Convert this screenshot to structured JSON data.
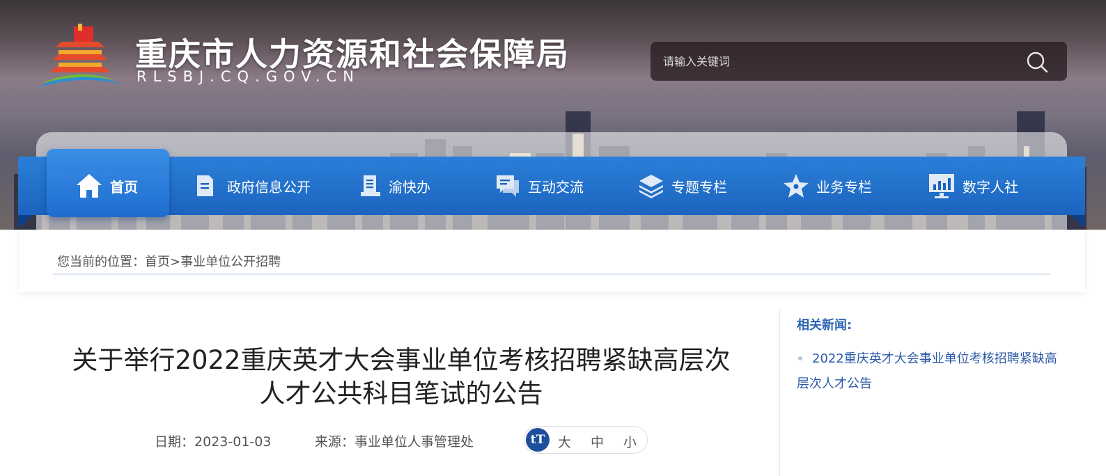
{
  "header": {
    "site_title": "重庆市人力资源和社会保障局",
    "site_domain": "RLSBJ.CQ.GOV.CN",
    "search_placeholder": "请输入关键词",
    "logo_icon": "temple-logo-icon",
    "search_icon": "search-icon"
  },
  "nav": {
    "items": [
      {
        "label": "首页",
        "icon": "home-icon",
        "active": true
      },
      {
        "label": "政府信息公开",
        "icon": "document-icon"
      },
      {
        "label": "渝快办",
        "icon": "book-icon"
      },
      {
        "label": "互动交流",
        "icon": "chat-icon"
      },
      {
        "label": "专题专栏",
        "icon": "layers-icon"
      },
      {
        "label": "业务专栏",
        "icon": "star-icon"
      },
      {
        "label": "数字人社",
        "icon": "monitor-chart-icon"
      }
    ]
  },
  "breadcrumb": {
    "prefix": "您当前的位置：",
    "home": "首页",
    "separator": ">",
    "current": "事业单位公开招聘"
  },
  "article": {
    "title": "关于举行2022重庆英才大会事业单位考核招聘紧缺高层次人才公共科目笔试的公告",
    "date_label": "日期：",
    "date": "2023-01-03",
    "source_label": "来源：",
    "source": "事业单位人事管理处",
    "fontsize_icon": "tT",
    "fontsize_large": "大",
    "fontsize_medium": "中",
    "fontsize_small": "小"
  },
  "sidebar": {
    "title": "相关新闻:",
    "items": [
      "2022重庆英才大会事业单位考核招聘紧缺高层次人才公告"
    ]
  },
  "colors": {
    "nav_blue": "#1b64bf",
    "link_blue": "#2d5aa6",
    "title_blue": "#2d66b3",
    "fontsize_icon_bg": "#1e4f9c"
  }
}
